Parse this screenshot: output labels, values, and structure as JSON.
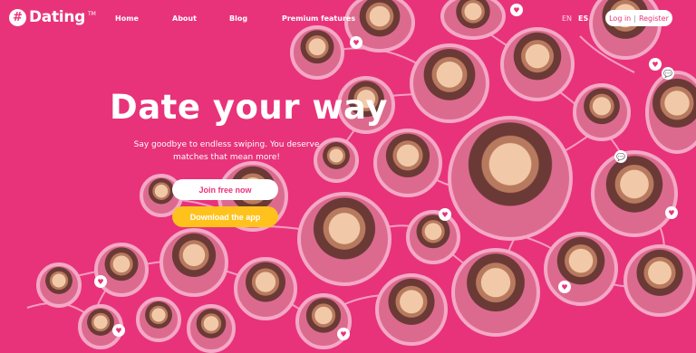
{
  "brand": {
    "icon": "#",
    "name": "Dating",
    "tm": "TM"
  },
  "nav": {
    "home": "Home",
    "about": "About",
    "blog": "Blog",
    "premium": "Premium features"
  },
  "lang": {
    "en": "EN",
    "es": "ES"
  },
  "auth": {
    "login": "Log in",
    "sep": "|",
    "register": "Register"
  },
  "hero": {
    "title": "Date your way",
    "subtitle": "Say goodbye to endless swiping. You deserve matches that mean more!",
    "join": "Join free now",
    "download": "Download the app"
  },
  "icons": {
    "heart": "♥",
    "chat": "💬"
  },
  "colors": {
    "background": "#e8337a",
    "accent_yellow": "#ffc21c",
    "white": "#ffffff"
  }
}
